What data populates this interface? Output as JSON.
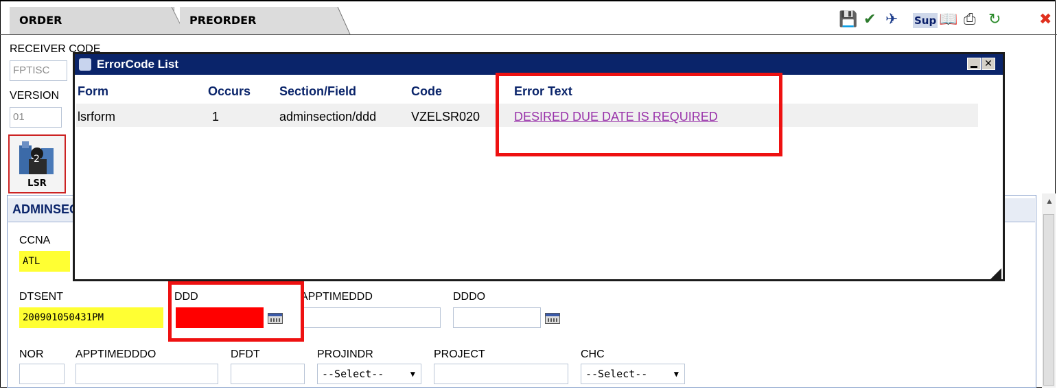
{
  "tabs": {
    "order": "ORDER",
    "preorder": "PREORDER"
  },
  "toolbar": {
    "sup_label": "Sup"
  },
  "form": {
    "receiver_code_label": "RECEIVER CODE",
    "receiver_code_value": "FPTISC",
    "version_label": "VERSION",
    "version_value": "01",
    "lsr_label": "LSR",
    "section_label": "ADMINSECTION",
    "ccna_label": "CCNA",
    "ccna_value": "ATL",
    "dtsent_label": "DTSENT",
    "dtsent_value": "200901050431PM",
    "ddd_label": "DDD",
    "apptimeddd_label": "APPTIMEDDD",
    "dddo_label": "DDDO",
    "nor_label": "NOR",
    "apptimedddo_label": "APPTIMEDDDO",
    "dfdt_label": "DFDT",
    "projindr_label": "PROJINDR",
    "projindr_value": "--Select--",
    "project_label": "PROJECT",
    "chc_label": "CHC",
    "chc_value": "--Select--"
  },
  "dialog": {
    "title": "ErrorCode List",
    "columns": [
      "Form",
      "Occurs",
      "Section/Field",
      "Code",
      "Error Text"
    ],
    "row": {
      "form": "lsrform",
      "occurs": "1",
      "section_field": "adminsection/ddd",
      "code": "VZELSR020",
      "error_text": "DESIRED DUE DATE IS REQUIRED"
    }
  },
  "colors": {
    "title_bar": "#0a246a",
    "highlight": "#ee1111",
    "required_field": "#ffff33",
    "error_link": "#9933aa"
  }
}
